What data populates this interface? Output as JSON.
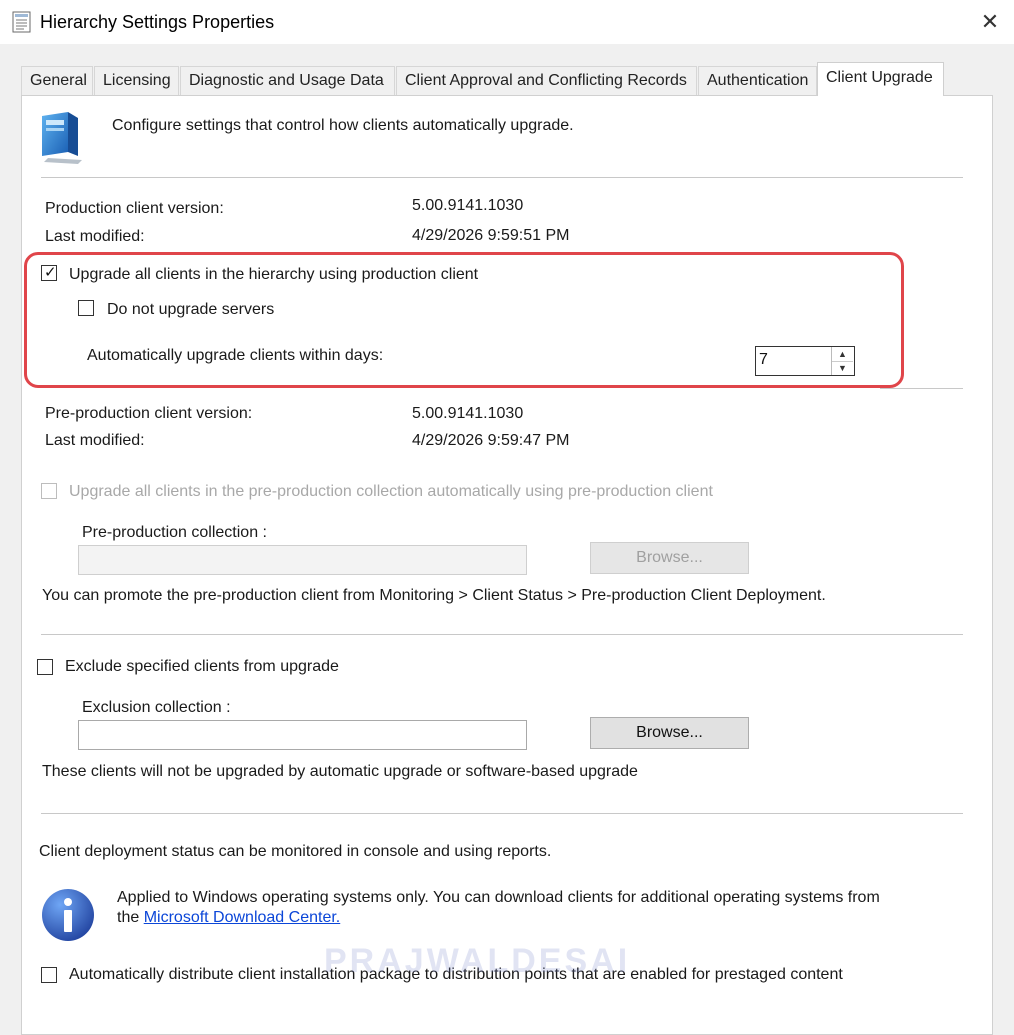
{
  "window": {
    "title": "Hierarchy Settings Properties",
    "close_glyph": "✕"
  },
  "tabs": [
    {
      "label": "General",
      "active": false
    },
    {
      "label": "Licensing",
      "active": false
    },
    {
      "label": "Diagnostic and Usage Data",
      "active": false
    },
    {
      "label": "Client Approval and Conflicting Records",
      "active": false
    },
    {
      "label": "Authentication",
      "active": false
    },
    {
      "label": "Client Upgrade",
      "active": true
    }
  ],
  "header": {
    "icon": "client-computer-icon",
    "description": "Configure settings that control how clients automatically upgrade."
  },
  "production": {
    "version_label": "Production client version:",
    "version_value": "5.00.9141.1030",
    "modified_label": "Last modified:",
    "modified_value": "4/29/2026 9:59:51 PM",
    "upgrade_all_label": "Upgrade all clients in the hierarchy using production client",
    "upgrade_all_checked": true,
    "no_servers_label": "Do not upgrade servers",
    "no_servers_checked": false,
    "days_label": "Automatically upgrade clients within days:",
    "days_value": "7"
  },
  "preproduction": {
    "version_label": "Pre-production client version:",
    "version_value": "5.00.9141.1030",
    "modified_label": "Last modified:",
    "modified_value": "4/29/2026 9:59:47 PM",
    "upgrade_label": "Upgrade all clients in the pre-production collection automatically using pre-production client",
    "upgrade_checked": false,
    "collection_label": "Pre-production collection :",
    "collection_value": "",
    "browse_label": "Browse...",
    "promote_note": "You can promote the pre-production client from Monitoring > Client Status > Pre-production Client Deployment."
  },
  "exclusion": {
    "exclude_label": "Exclude specified clients from upgrade",
    "exclude_checked": false,
    "collection_label": "Exclusion collection :",
    "collection_value": "",
    "browse_label": "Browse...",
    "note": "These clients will not be upgraded by automatic upgrade or software-based upgrade"
  },
  "deployment": {
    "status_note": "Client deployment status can be monitored in console and using reports.",
    "info_icon": "info-icon",
    "info_text_1": "Applied to Windows operating systems only. You can download clients for additional operating systems from",
    "info_text_2": "the",
    "info_link": "Microsoft Download Center.",
    "distribute_label": "Automatically distribute client installation package to distribution points that are enabled for prestaged content",
    "distribute_checked": false
  },
  "watermark": "PRAJWALDESAI",
  "colors": {
    "highlight_border": "#e0454a",
    "link": "#0b46d8",
    "disabled_text": "#a8a8a8"
  }
}
